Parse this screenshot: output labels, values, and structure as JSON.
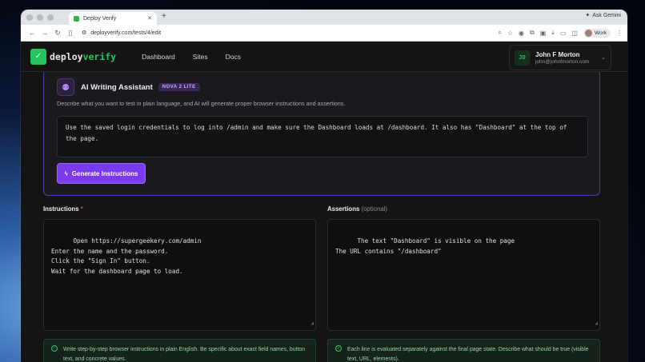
{
  "browser": {
    "tab_title": "Deploy Verify",
    "url": "deployverify.com/tests/4/edit",
    "ask_gemini": "Ask Gemini",
    "profile_label": "Work"
  },
  "app": {
    "brand_part1": "deploy",
    "brand_part2": "verify",
    "nav": [
      "Dashboard",
      "Sites",
      "Docs"
    ],
    "user": {
      "initials": "JO",
      "name": "John F Morton",
      "email": "john@johnfmorton.com"
    }
  },
  "ai_assistant": {
    "title": "AI Writing Assistant",
    "badge": "NOVA 2 LITE",
    "description": "Describe what you want to test in plain language, and AI will generate proper browser instructions and assertions.",
    "prompt": "Use the saved login credentials to log into /admin and make sure the Dashboard loads at /dashboard. It also has \"Dashboard\" at the top of the page.",
    "button_label": "Generate Instructions"
  },
  "instructions": {
    "label": "Instructions",
    "required_mark": "*",
    "value": "Open https://supergeekery.com/admin\nEnter the name and the password.\nClick the \"Sign In\" button.\nWait for the dashboard page to load.",
    "hint": "Write step-by-step browser instructions in plain English. Be specific about exact field names, button text, and concrete values."
  },
  "assertions": {
    "label": "Assertions",
    "optional": "(optional)",
    "value": "The text \"Dashboard\" is visible on the page\nThe URL contains \"/dashboard\"",
    "hint": "Each line is evaluated separately against the final page state. Describe what should be true (visible text, URL, elements)."
  }
}
